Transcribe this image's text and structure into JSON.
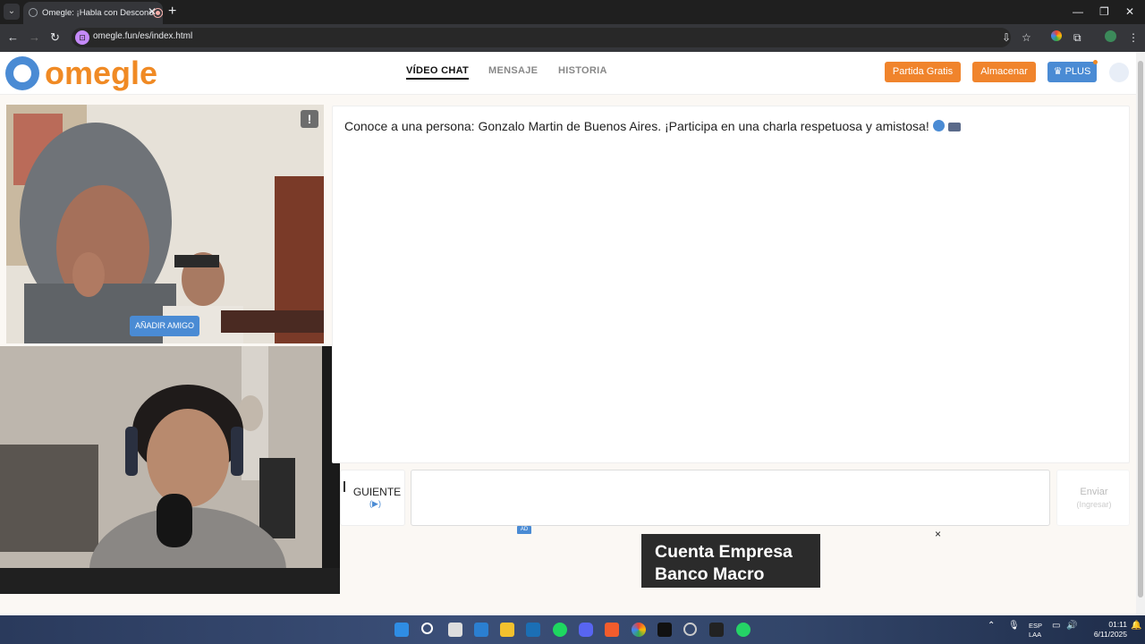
{
  "browser": {
    "tab_title": "Omegle: ¡Habla con Desconocidos",
    "close_glyph": "✕",
    "new_tab_glyph": "+",
    "url": "omegle.fun/es/index.html",
    "back_glyph": "←",
    "forward_glyph": "→",
    "reload_glyph": "↻",
    "minimize_glyph": "—",
    "maximize_glyph": "❐",
    "window_close_glyph": "✕",
    "install_glyph": "⇩",
    "star_glyph": "☆",
    "extensions_glyph": "⧉",
    "menu_glyph": "⋮"
  },
  "header": {
    "logo_text": "omegle",
    "nav": [
      "VÍDEO CHAT",
      "MENSAJE",
      "HISTORIA"
    ],
    "partida_label": "Partida Gratis",
    "almacenar_label": "Almacenar",
    "plus_label": "♛ PLUS"
  },
  "video": {
    "report_label": "!",
    "add_friend_label": "AÑADIR AMIGO"
  },
  "chat": {
    "message": "Conoce a una persona: Gonzalo Martin de Buenos Aires. ¡Participa en una charla respetuosa y amistosa!",
    "next_label": "GUIENTE",
    "next_hint": "(▶)",
    "input_value": "",
    "send_label": "Enviar",
    "send_hint": "(Ingresar)"
  },
  "ad": {
    "tag": "AD",
    "line1": "Cuenta Empresa",
    "line2": "Banco Macro",
    "close": "×"
  },
  "taskbar": {
    "lang1": "ESP",
    "lang2": "LAA",
    "time": "01:11",
    "date": "6/11/2025",
    "tray_chevron": "⌃"
  },
  "colors": {
    "accent_orange": "#f08a24",
    "accent_blue": "#4a8bd4"
  }
}
